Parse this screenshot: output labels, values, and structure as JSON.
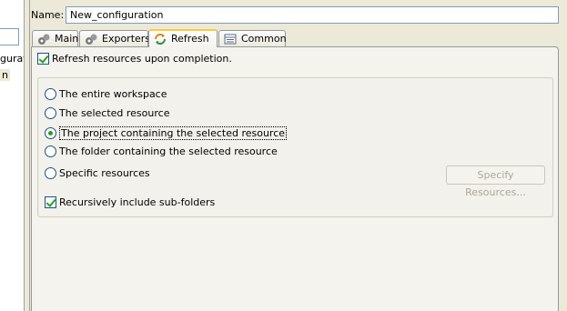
{
  "left_panel": {
    "item1": "guratio",
    "item2": "n"
  },
  "name_field": {
    "label": "Name:",
    "value": "New_configuration"
  },
  "tabs": [
    {
      "label": "Main",
      "icon": "main-icon",
      "active": false
    },
    {
      "label": "Exporters",
      "icon": "exporters-icon",
      "active": false
    },
    {
      "label": "Refresh",
      "icon": "refresh-icon",
      "active": true
    },
    {
      "label": "Common",
      "icon": "common-icon",
      "active": false
    }
  ],
  "refresh": {
    "upon_completion_label": "Refresh resources upon completion.",
    "upon_completion_checked": true,
    "options": [
      {
        "label": "The entire workspace",
        "checked": false
      },
      {
        "label": "The selected resource",
        "checked": false
      },
      {
        "label": "The project containing the selected resource",
        "checked": true
      },
      {
        "label": "The folder containing the selected resource",
        "checked": false
      },
      {
        "label": "Specific resources",
        "checked": false
      }
    ],
    "specify_button_label": "Specify Resources...",
    "recursive_label": "Recursively include sub-folders",
    "recursive_checked": true
  },
  "colors": {
    "window_bg": "#ece9d8",
    "active_tab_accent": "#ffc83c",
    "check_green": "#21a121"
  }
}
